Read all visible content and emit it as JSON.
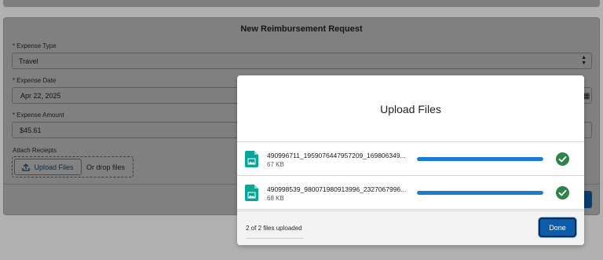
{
  "form": {
    "title": "New Reimbursement Request",
    "expense_type": {
      "label": "Expense Type",
      "required_marker": "*",
      "value": "Travel"
    },
    "expense_date": {
      "label": "Expense Date",
      "required_marker": "*",
      "value": "Apr 22, 2025"
    },
    "expense_amount": {
      "label": "Expense Amount",
      "required_marker": "*",
      "value": "$45.61"
    },
    "attach": {
      "label": "Attach Reciepts",
      "upload_button": "Upload Files",
      "drop_text": "Or drop files"
    }
  },
  "modal": {
    "title": "Upload Files",
    "files": [
      {
        "name": "490996711_1959076447957209_169806349...",
        "size": "67 KB",
        "progress": 1.0,
        "status": "complete"
      },
      {
        "name": "490998539_980071980913996_2327067996...",
        "size": "68 KB",
        "progress": 1.0,
        "status": "complete"
      }
    ],
    "status_text": "2 of 2 files uploaded",
    "done_label": "Done"
  },
  "colors": {
    "accent": "#0b5cab",
    "progress": "#1a7ccb",
    "success": "#2e844a",
    "file_icon": "#06a59a"
  }
}
